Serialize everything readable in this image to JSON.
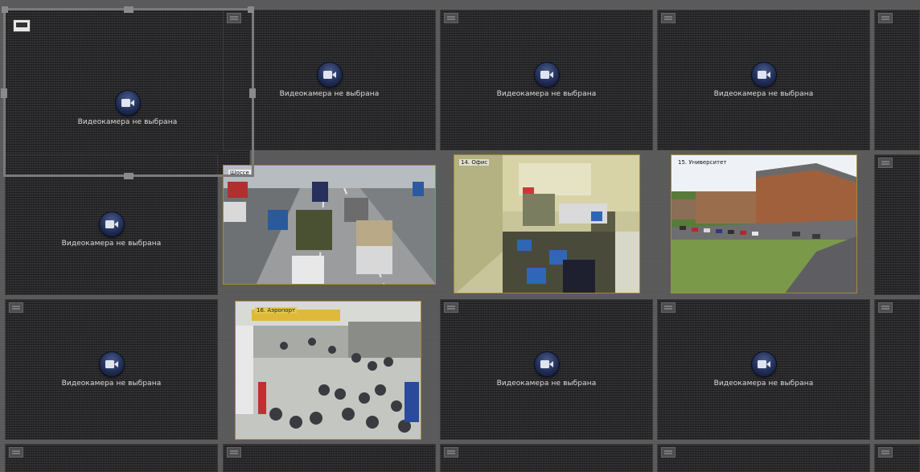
{
  "empty_tile_label": "Видеокамера не выбрана",
  "cameras": {
    "c13": {
      "name": "Шоссе"
    },
    "c14": {
      "name": "14. Офис"
    },
    "c15": {
      "name": "15. Университет"
    },
    "c16": {
      "name": "16. Аэропорт"
    }
  },
  "colors": {
    "selection_frame": "#7a7a7c",
    "video_border": "#a58a3a",
    "placeholder_button": "#1e2b52"
  }
}
